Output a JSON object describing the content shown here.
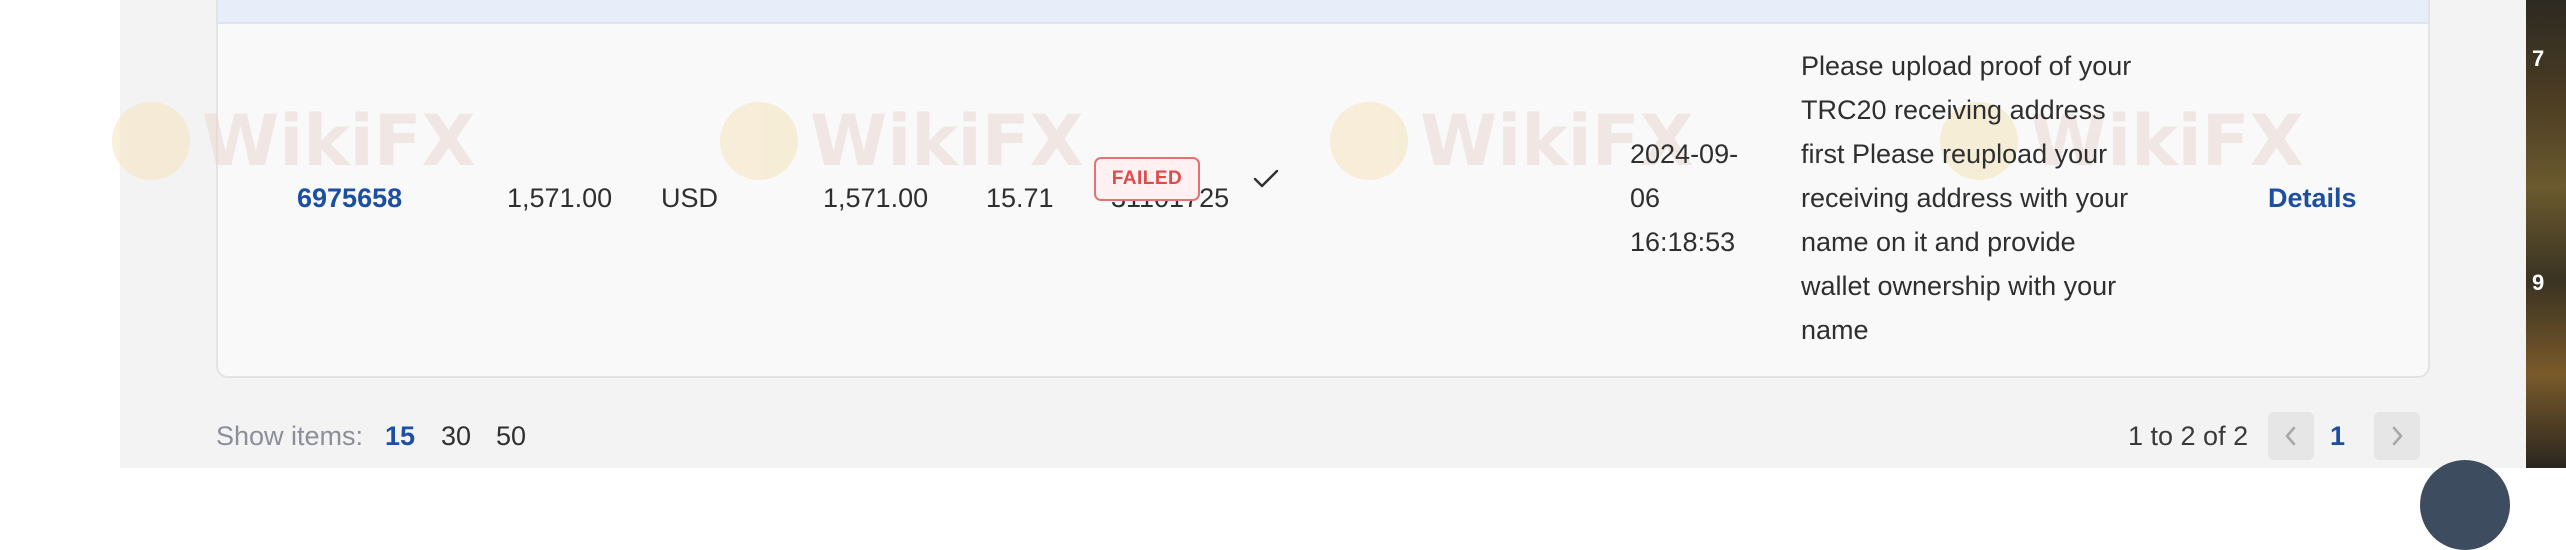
{
  "row": {
    "order_id": "6975658",
    "amount": "1,571.00",
    "currency": "USD",
    "actual_amount": "1,571.00",
    "fee": "15.71",
    "reference": "31101725",
    "status": "FAILED",
    "datetime": "2024-09-\n06\n16:18:53",
    "remark": "Please upload proof of your\nTRC20 receiving address\nfirst Please reupload your\nreceiving address with your\nname on it and provide\nwallet ownership with your\nname",
    "details_label": "Details"
  },
  "pagination": {
    "show_label": "Show items:",
    "page_sizes": [
      "15",
      "30",
      "50"
    ],
    "active_page_size": "15",
    "range_text": "1 to 2 of 2",
    "current_page": "1"
  },
  "watermark": {
    "text": "WikiFX"
  },
  "edge_numbers": [
    "7",
    "9"
  ],
  "icons": {
    "check": "check-icon",
    "prev": "chevron-left-icon",
    "next": "chevron-right-icon"
  },
  "colors": {
    "link": "#1d4fa0",
    "failed": "#e04a4a",
    "header_bg": "#e8eef9"
  }
}
